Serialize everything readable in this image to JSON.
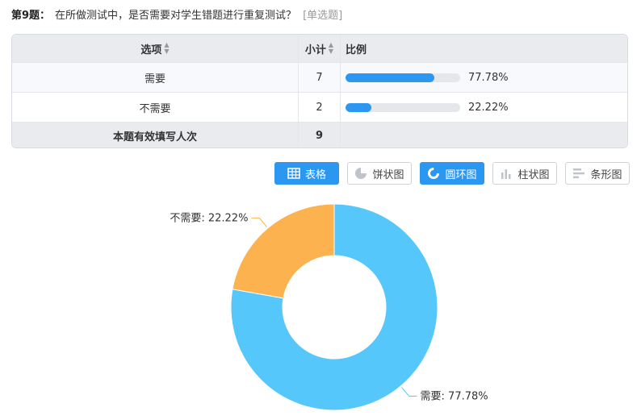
{
  "question": {
    "number": "第9题：",
    "text": "在所做测试中，是否需要对学生错题进行重复测试？",
    "type": "[单选题]"
  },
  "table": {
    "headers": {
      "option": "选项",
      "count": "小计",
      "ratio": "比例"
    },
    "rows": [
      {
        "option": "需要",
        "count": "7",
        "percent": "77.78%",
        "fraction": 0.7778
      },
      {
        "option": "不需要",
        "count": "2",
        "percent": "22.22%",
        "fraction": 0.2222
      }
    ],
    "footer": {
      "label": "本题有效填写人次",
      "total": "9"
    }
  },
  "toolbar": {
    "buttons": [
      {
        "label": "表格",
        "icon": "table-icon",
        "active": true
      },
      {
        "label": "饼状图",
        "icon": "pie-chart-icon",
        "active": false
      },
      {
        "label": "圆环图",
        "icon": "donut-chart-icon",
        "active": true
      },
      {
        "label": "柱状图",
        "icon": "bar-chart-icon",
        "active": false
      },
      {
        "label": "条形图",
        "icon": "horizontal-bar-chart-icon",
        "active": false
      }
    ]
  },
  "chart_data": {
    "type": "pie",
    "variant": "donut",
    "categories": [
      "需要",
      "不需要"
    ],
    "values": [
      77.78,
      22.22
    ],
    "labels": [
      "需要: 77.78%",
      "不需要: 22.22%"
    ],
    "colors": [
      "#56c7fa",
      "#fbb24f"
    ],
    "title": "",
    "legend": "none"
  }
}
